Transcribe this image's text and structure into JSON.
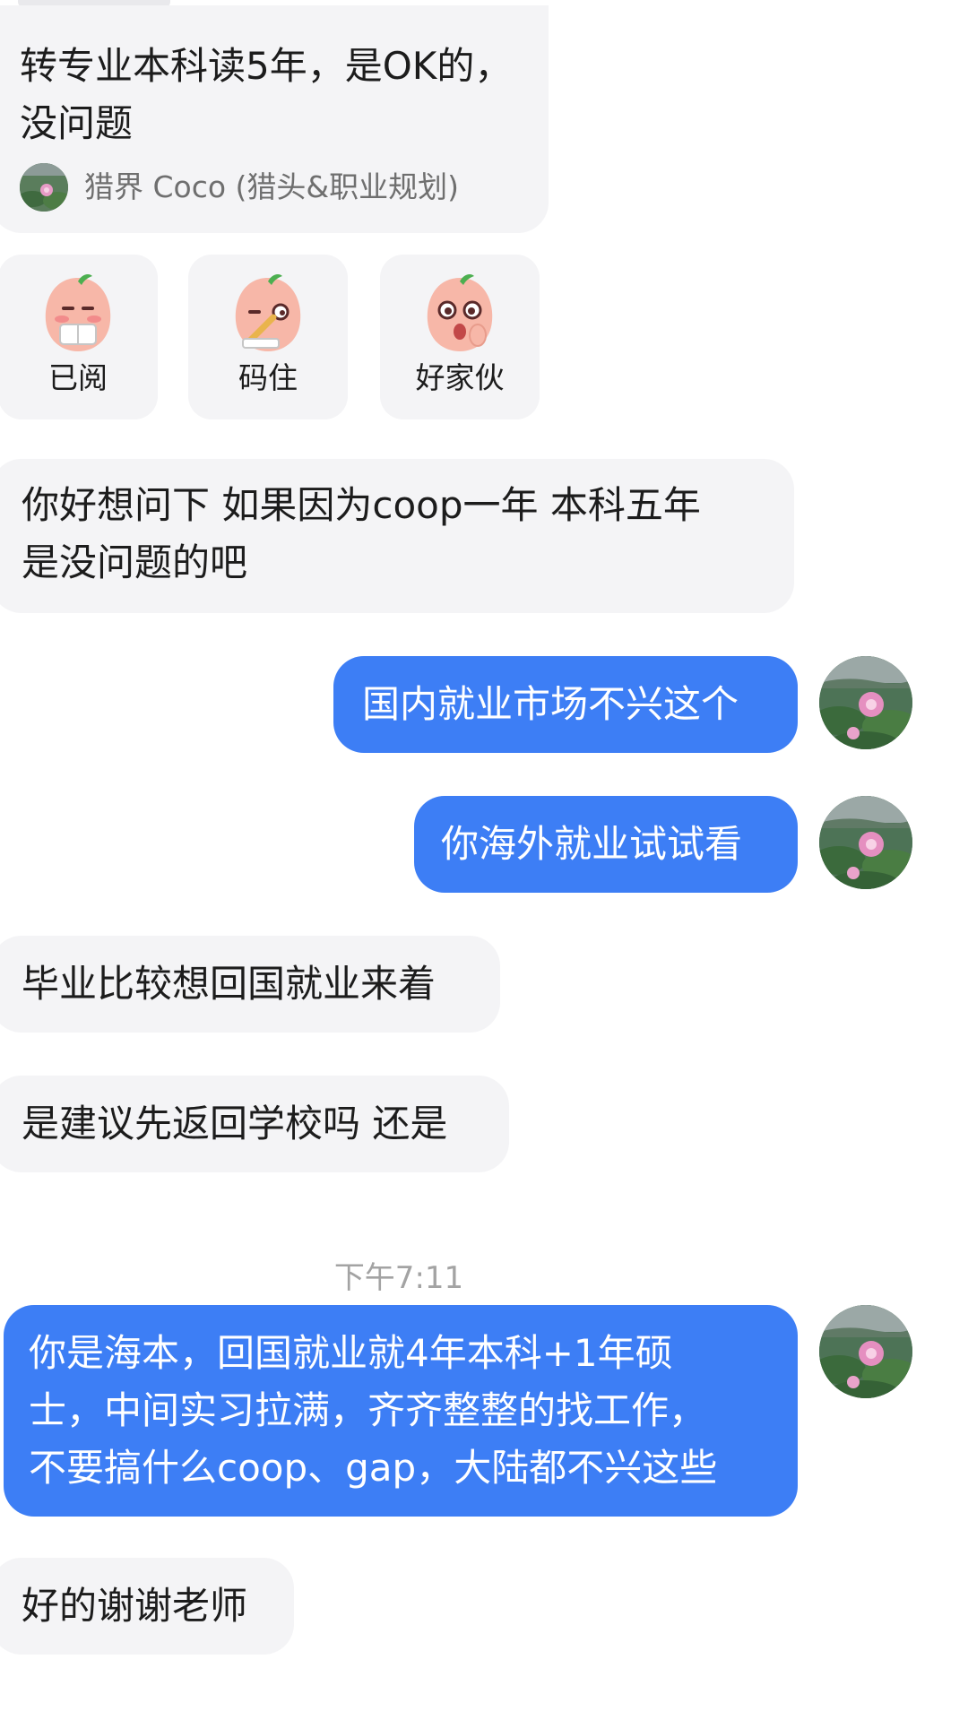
{
  "messages": {
    "quoted": {
      "text_line1": "转专业本科读5年，是OK的，",
      "text_line2": "没问题",
      "author": "猎界 Coco (猎头&职业规划)"
    },
    "stickers": [
      {
        "label": "已阅",
        "icon": "sticker-reading-icon"
      },
      {
        "label": "码住",
        "icon": "sticker-writing-icon"
      },
      {
        "label": "好家伙",
        "icon": "sticker-surprised-icon"
      }
    ],
    "m1_line1": "你好想问下 如果因为coop一年 本科五年",
    "m1_line2": "是没问题的吧",
    "m2": "国内就业市场不兴这个",
    "m3": "你海外就业试试看",
    "m4": "毕业比较想回国就业来着",
    "m5": "是建议先返回学校吗 还是",
    "timestamp": "下午7:11",
    "m6_line1": "你是海本，回国就业就4年本科+1年硕",
    "m6_line2": "士，中间实习拉满，齐齐整整的找工作，",
    "m6_line3": "不要搞什么coop、gap，大陆都不兴这些",
    "m7": "好的谢谢老师"
  },
  "colors": {
    "outgoing_bubble": "#3d7ef5",
    "incoming_bubble": "#f4f4f6",
    "timestamp_text": "#a3a3a3"
  }
}
